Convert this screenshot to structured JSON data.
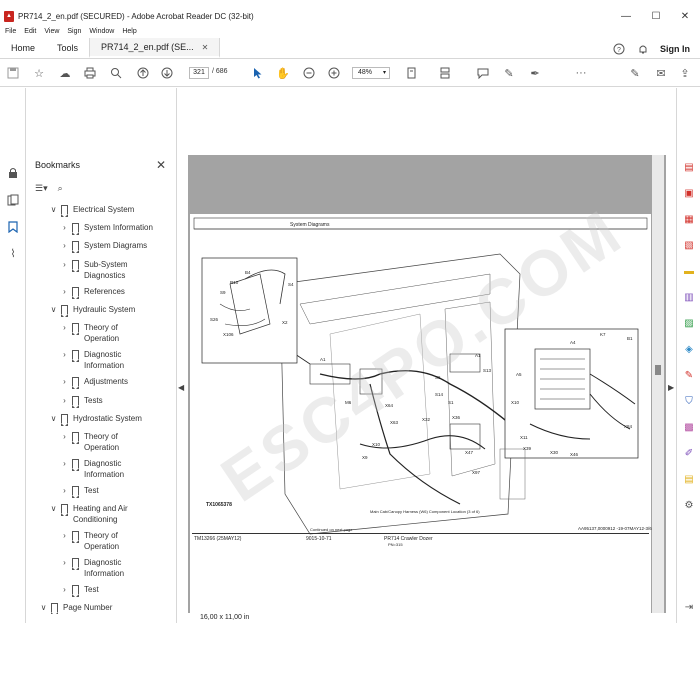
{
  "window": {
    "title": "PR714_2_en.pdf (SECURED) - Adobe Acrobat Reader DC (32-bit)",
    "minimize": "—",
    "maximize": "☐",
    "close": "✕"
  },
  "menu": [
    "File",
    "Edit",
    "View",
    "Sign",
    "Window",
    "Help"
  ],
  "tabs": {
    "home": "Home",
    "tools": "Tools",
    "document": "PR714_2_en.pdf (SE...",
    "sign_in": "Sign In"
  },
  "toolbar": {
    "page_current": "321",
    "page_total": "/ 686",
    "zoom": "48%",
    "more": "···"
  },
  "bookmarks": {
    "header": "Bookmarks",
    "items": [
      {
        "label": "Electrical System",
        "level": 1,
        "expanded": true
      },
      {
        "label": "System Information",
        "level": 2
      },
      {
        "label": "System Diagrams",
        "level": 2
      },
      {
        "label": "Sub-System Diagnostics",
        "level": 2
      },
      {
        "label": "References",
        "level": 2
      },
      {
        "label": "Hydraulic System",
        "level": 1,
        "expanded": true
      },
      {
        "label": "Theory of Operation",
        "level": 2
      },
      {
        "label": "Diagnostic Information",
        "level": 2
      },
      {
        "label": "Adjustments",
        "level": 2
      },
      {
        "label": "Tests",
        "level": 2
      },
      {
        "label": "Hydrostatic System",
        "level": 1,
        "expanded": true
      },
      {
        "label": "Theory of Operation",
        "level": 2
      },
      {
        "label": "Diagnostic Information",
        "level": 2
      },
      {
        "label": "Test",
        "level": 2
      },
      {
        "label": "Heating and Air Conditioning",
        "level": 1,
        "expanded": true
      },
      {
        "label": "Theory of Operation",
        "level": 2
      },
      {
        "label": "Diagnostic Information",
        "level": 2
      },
      {
        "label": "Test",
        "level": 2
      },
      {
        "label": "Page Number",
        "level": 0,
        "expanded": true
      }
    ]
  },
  "status": {
    "page_size": "16,00 x 11,00 in"
  },
  "pdf_page": {
    "header": "System Diagrams",
    "ref_code": "TX1065378",
    "footer_left": "TM13266 (25MAY12)",
    "footer_center": "9015-10-71",
    "footer_right_top": "PR714 Crawler Dozer",
    "footer_right_bottom": "PN=315",
    "footer_code": "AA95137,0000912 -19-07MAY12-3/6",
    "continued": "Continued on next page",
    "caption": "Main Cab/Canopy Harness (W6) Component Location (3 of 6)"
  },
  "watermark": "ESC4PO.COM",
  "colors": {
    "accent": "#1b63b0",
    "pdf_red": "#c8251f",
    "viewer_bg": "#a3a3a3"
  }
}
